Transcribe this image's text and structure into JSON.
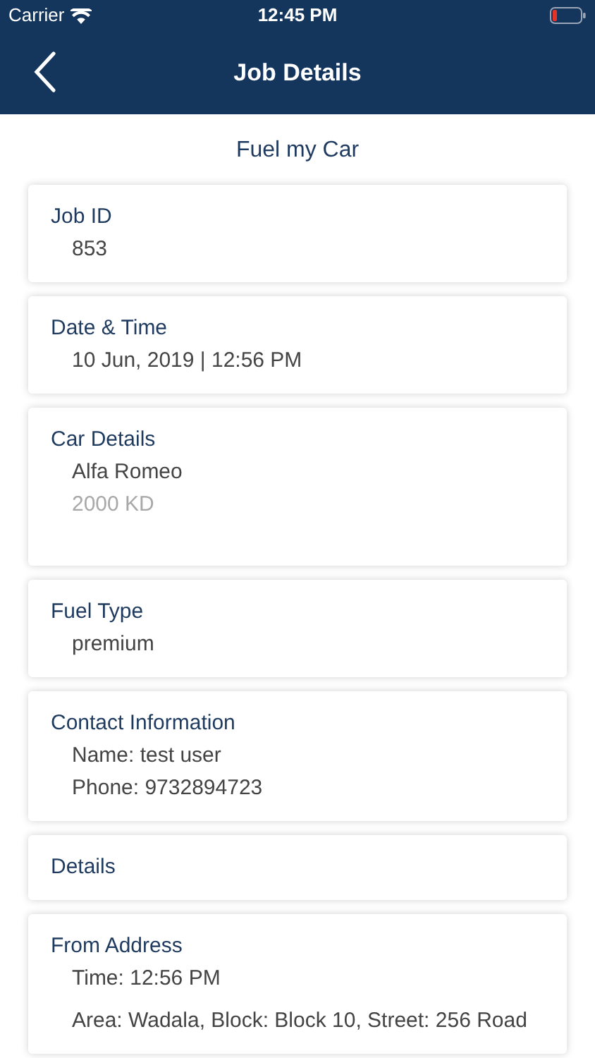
{
  "status_bar": {
    "carrier": "Carrier",
    "time": "12:45 PM"
  },
  "nav_bar": {
    "title": "Job Details"
  },
  "service_title": "Fuel my Car",
  "cards": [
    {
      "title": "Job ID",
      "lines": [
        {
          "text": "853",
          "kind": "primary"
        }
      ]
    },
    {
      "title": "Date & Time",
      "lines": [
        {
          "text": "10 Jun, 2019 | 12:56 PM",
          "kind": "primary"
        }
      ]
    },
    {
      "title": "Car Details",
      "tall": true,
      "lines": [
        {
          "text": "Alfa Romeo",
          "kind": "primary"
        },
        {
          "text": "2000 KD",
          "kind": "secondary"
        }
      ]
    },
    {
      "title": "Fuel Type",
      "lines": [
        {
          "text": "premium",
          "kind": "primary"
        }
      ]
    },
    {
      "title": "Contact Information",
      "lines": [
        {
          "text": "Name: test user",
          "kind": "primary"
        },
        {
          "text": "Phone: 9732894723",
          "kind": "primary"
        }
      ]
    },
    {
      "title": "Details"
    },
    {
      "title": "From Address",
      "lines": [
        {
          "text": "Time: 12:56 PM",
          "kind": "primary"
        },
        {
          "text": "Area: Wadala, Block: Block 10, Street: 256 Road",
          "kind": "address"
        }
      ]
    }
  ]
}
